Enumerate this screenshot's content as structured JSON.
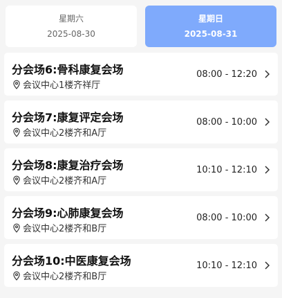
{
  "tabs": [
    {
      "day": "星期六",
      "date": "2025-08-30",
      "active": false
    },
    {
      "day": "星期日",
      "date": "2025-08-31",
      "active": true
    }
  ],
  "sessions": [
    {
      "title": "分会场6:骨科康复会场",
      "location": "会议中心1楼齐祥厅",
      "time": "08:00 - 12:20"
    },
    {
      "title": "分会场7:康复评定会场",
      "location": "会议中心2楼齐和A厅",
      "time": "08:00 - 10:00"
    },
    {
      "title": "分会场8:康复治疗会场",
      "location": "会议中心2楼齐和A厅",
      "time": "10:10 - 12:10"
    },
    {
      "title": "分会场9:心肺康复会场",
      "location": "会议中心2楼齐和B厅",
      "time": "08:00 - 10:00"
    },
    {
      "title": "分会场10:中医康复会场",
      "location": "会议中心2楼齐和B厅",
      "time": "10:10 - 12:10"
    }
  ],
  "icons": {
    "location": "location-pin-icon",
    "chevron": "chevron-right-icon"
  },
  "colors": {
    "active_tab": "#7faafc",
    "background": "#f5f5f5"
  }
}
